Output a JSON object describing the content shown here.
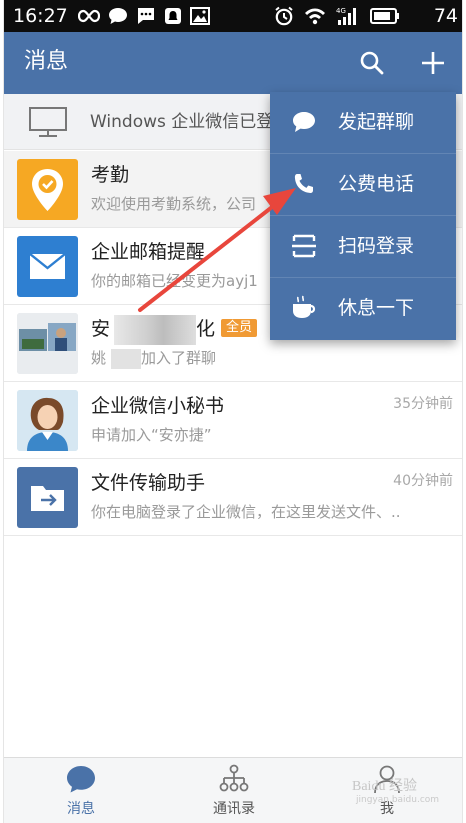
{
  "status_bar": {
    "time": "16:27",
    "battery": "74",
    "network": "4G"
  },
  "header": {
    "title": "消息",
    "search_icon": "search-icon",
    "add_icon": "plus-icon"
  },
  "windows_bar": {
    "text": "Windows 企业微信已登",
    "icon": "monitor-icon"
  },
  "conversations": [
    {
      "title": "考勤",
      "subtitle": "欢迎使用考勤系统，公司",
      "time": "",
      "avatar": "location-check-icon",
      "color": "#f6a823"
    },
    {
      "title": "企业邮箱提醒",
      "subtitle": "你的邮箱已经变更为ayj1",
      "time": "",
      "avatar": "mail-icon",
      "color": "#2e7fd1"
    },
    {
      "title": "安",
      "title_tail": "化",
      "badge": "全员",
      "subtitle": "姚",
      "subtitle_tail": "加入了群聊",
      "time": "",
      "avatar": "group-photo"
    },
    {
      "title": "企业微信小秘书",
      "subtitle": "申请加入“安亦捷”",
      "time": "35分钟前",
      "avatar": "assistant-avatar"
    },
    {
      "title": "文件传输助手",
      "subtitle": "你在电脑登录了企业微信，在这里发送文件、..",
      "time": "40分钟前",
      "avatar": "folder-icon",
      "color": "#4a72a8"
    }
  ],
  "menu": {
    "items": [
      {
        "label": "发起群聊",
        "icon": "chat-bubble-icon"
      },
      {
        "label": "公费电话",
        "icon": "phone-icon"
      },
      {
        "label": "扫码登录",
        "icon": "scan-icon"
      },
      {
        "label": "休息一下",
        "icon": "coffee-icon"
      }
    ]
  },
  "tabs": [
    {
      "label": "消息",
      "icon": "message-icon",
      "active": true
    },
    {
      "label": "通讯录",
      "icon": "contacts-icon",
      "active": false
    },
    {
      "label": "我",
      "icon": "profile-icon",
      "active": false
    }
  ],
  "watermark": {
    "text": "Baidu 经验",
    "sub": "jingyan.baidu.com"
  },
  "colors": {
    "brand": "#4a72a8",
    "arrow": "#e8463c",
    "badge": "#f09a34"
  }
}
